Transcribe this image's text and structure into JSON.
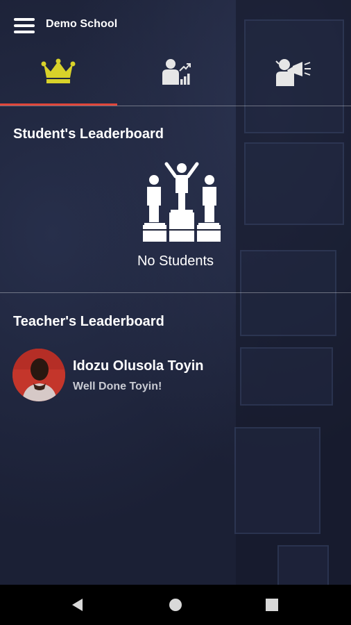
{
  "app": {
    "title": "Demo School"
  },
  "tabs": [
    {
      "icon": "crown-icon",
      "active": true
    },
    {
      "icon": "person-chart-icon",
      "active": false
    },
    {
      "icon": "megaphone-person-icon",
      "active": false
    }
  ],
  "student_leaderboard": {
    "title": "Student's Leaderboard",
    "empty_icon": "podium-winners-icon",
    "empty_text": "No Students"
  },
  "teacher_leaderboard": {
    "title": "Teacher's Leaderboard",
    "items": [
      {
        "name": "Idozu Olusola Toyin",
        "note": "Well Done Toyin!"
      }
    ]
  },
  "colors": {
    "background": "#1b2035",
    "active_tab_icon": "#d8d22a",
    "inactive_tab_icon": "#e6e6e6",
    "active_tab_indicator": "#e1463a",
    "navbar": "#000000"
  },
  "system_nav": [
    "back-icon",
    "home-icon",
    "recents-icon"
  ]
}
